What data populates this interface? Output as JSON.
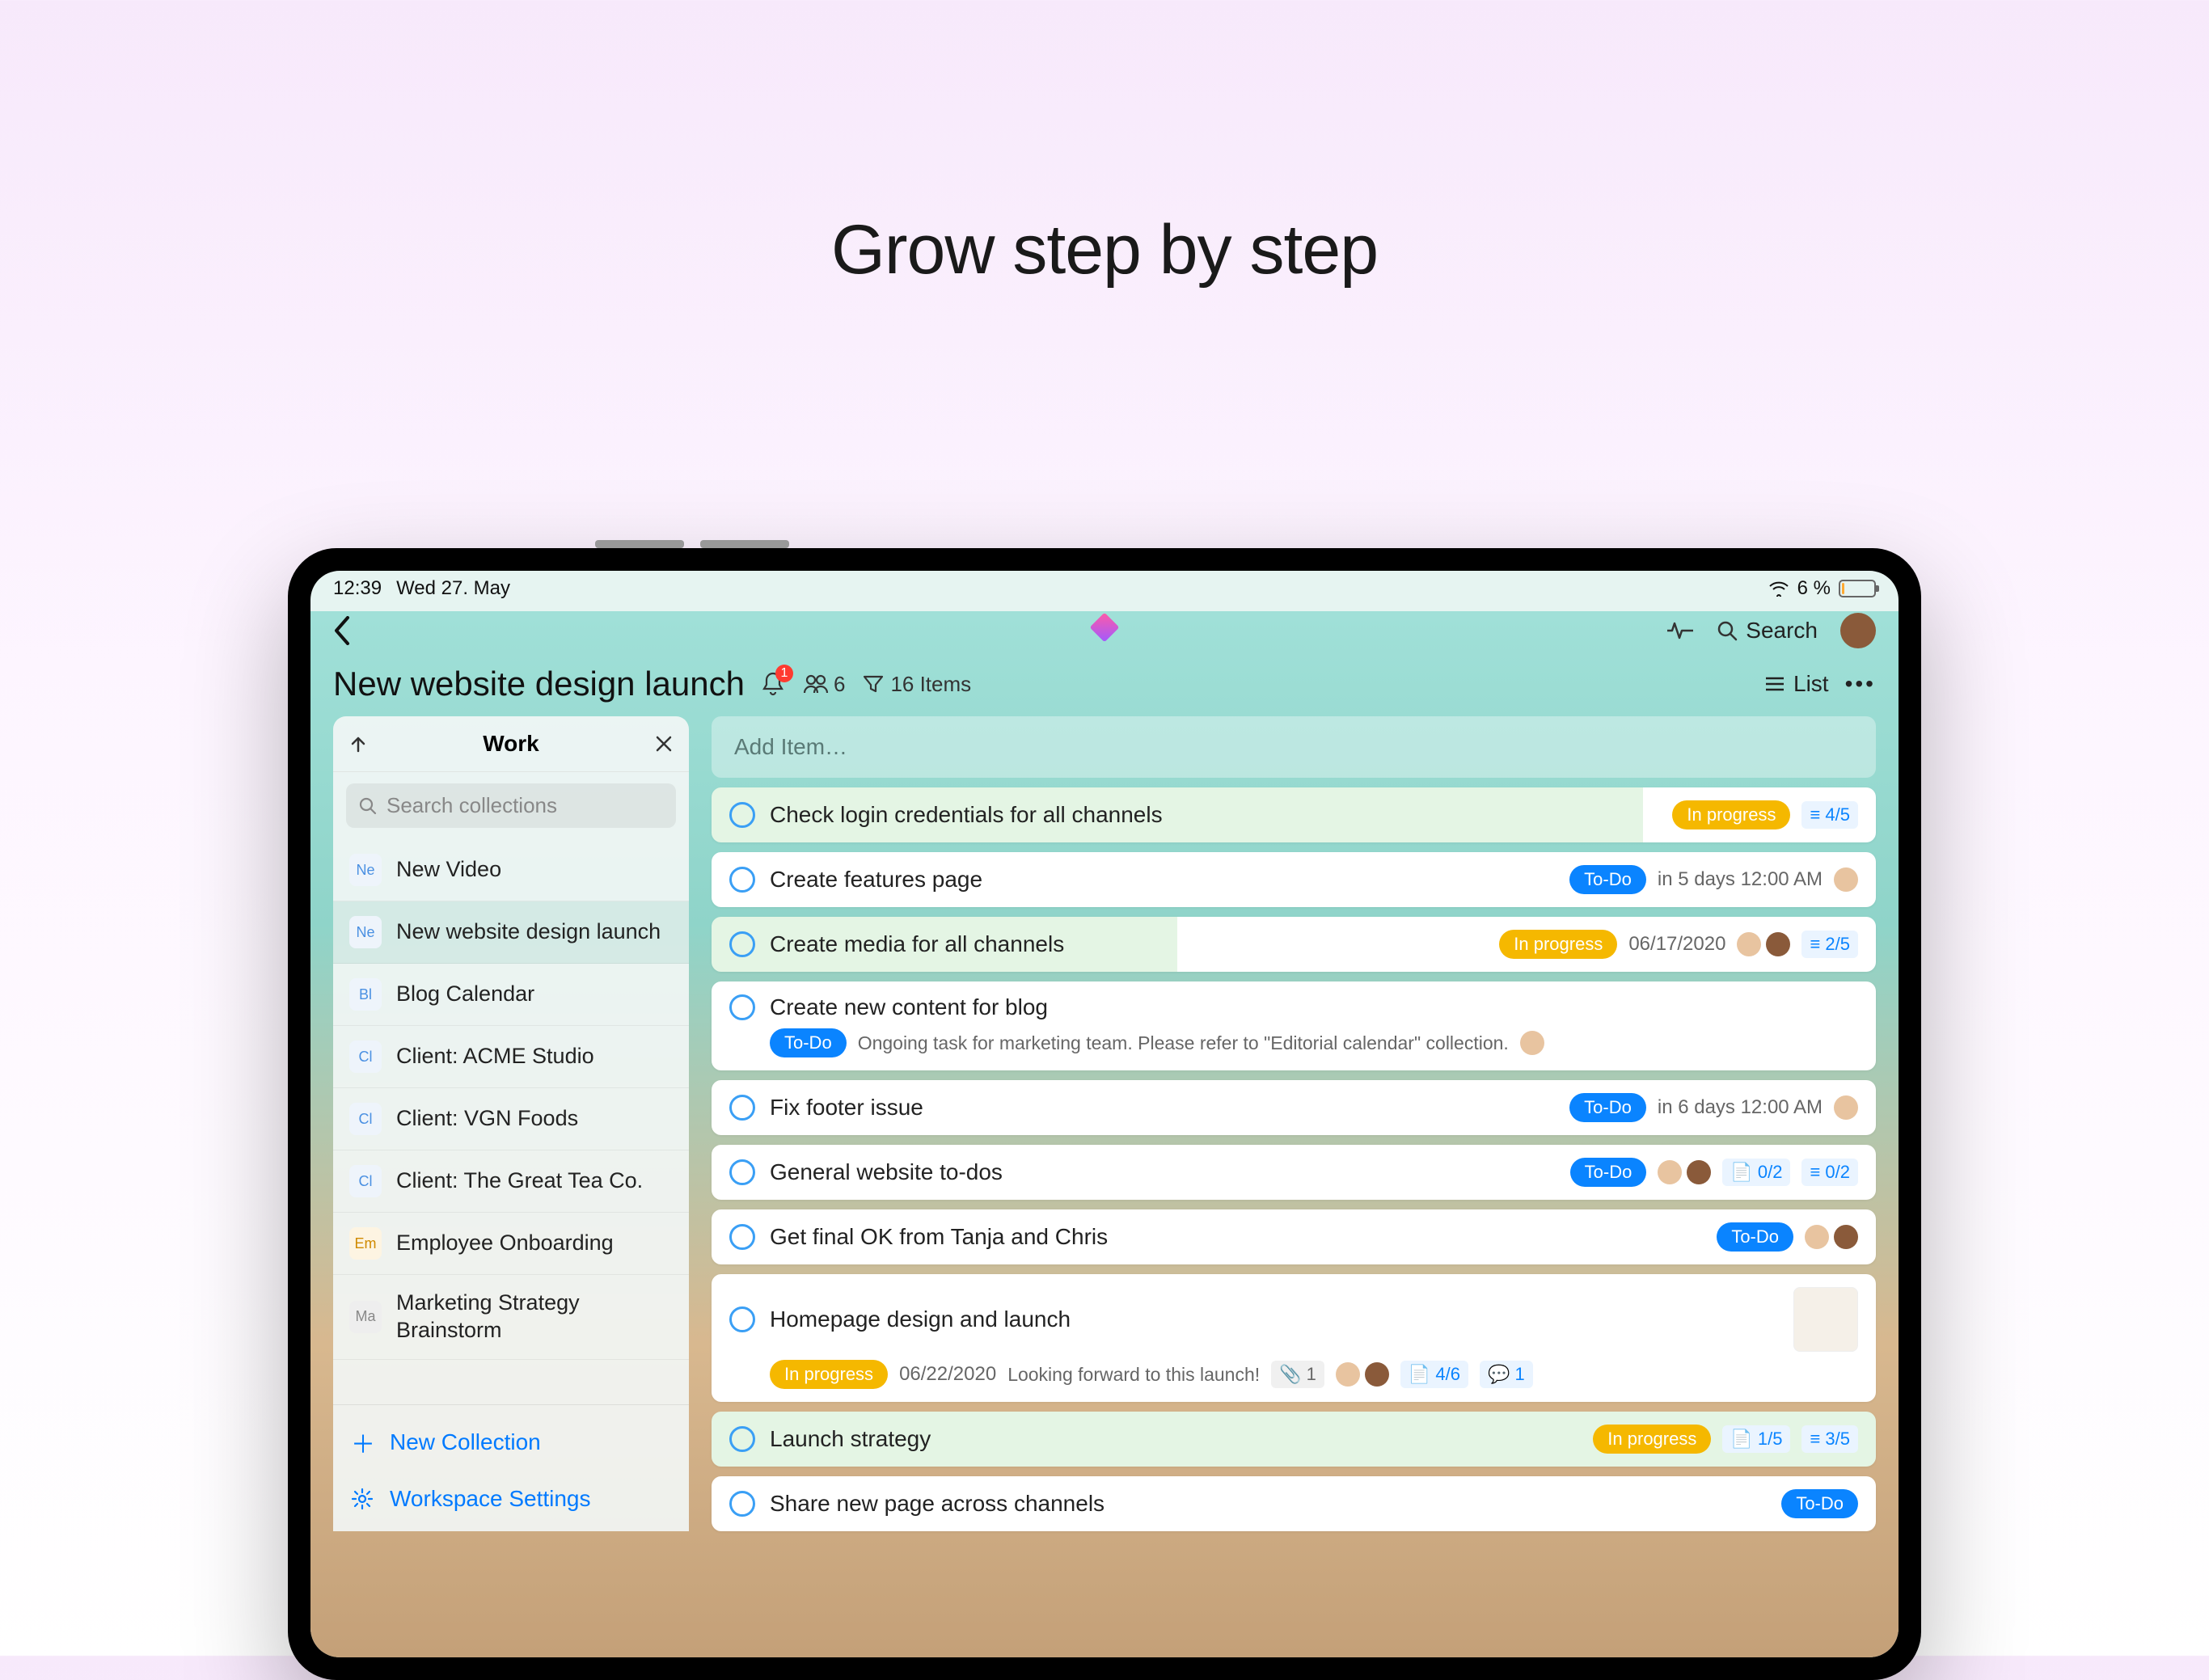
{
  "hero_title": "Grow step by step",
  "status_bar": {
    "time": "12:39",
    "date": "Wed 27. May",
    "battery_pct": "6 %"
  },
  "topbar": {
    "search_label": "Search"
  },
  "header": {
    "title": "New website design launch",
    "notification_count": "1",
    "members_count": "6",
    "items_count": "16 Items",
    "view_label": "List"
  },
  "sidebar": {
    "title": "Work",
    "search_placeholder": "Search collections",
    "collections": [
      {
        "badge": "Ne",
        "label": "New Video",
        "badge_class": ""
      },
      {
        "badge": "Ne",
        "label": "New website design launch",
        "badge_class": "",
        "selected": true
      },
      {
        "badge": "Bl",
        "label": "Blog Calendar",
        "badge_class": ""
      },
      {
        "badge": "Cl",
        "label": "Client: ACME Studio",
        "badge_class": ""
      },
      {
        "badge": "Cl",
        "label": "Client: VGN Foods",
        "badge_class": ""
      },
      {
        "badge": "Cl",
        "label": "Client: The Great Tea Co.",
        "badge_class": ""
      },
      {
        "badge": "Em",
        "label": "Employee Onboarding",
        "badge_class": "em"
      },
      {
        "badge": "Ma",
        "label": "Marketing Strategy Brainstorm",
        "badge_class": "ma"
      }
    ],
    "footer": {
      "new_collection": "New Collection",
      "workspace_settings": "Workspace Settings"
    }
  },
  "main": {
    "add_placeholder": "Add Item…",
    "tasks": [
      {
        "title": "Check login credentials for all channels",
        "status": "In progress",
        "status_class": "inprog",
        "progress": 80,
        "chips": [
          {
            "text": "4/5",
            "type": "list"
          }
        ]
      },
      {
        "title": "Create features page",
        "status": "To-Do",
        "status_class": "todo",
        "date": "in 5 days 12:00 AM",
        "avatars": 1
      },
      {
        "title": "Create media for all channels",
        "status": "In progress",
        "status_class": "inprog",
        "progress": 40,
        "date": "06/17/2020",
        "avatars": 2,
        "chips": [
          {
            "text": "2/5",
            "type": "list"
          }
        ]
      },
      {
        "title": "Create new content for blog",
        "status": "To-Do",
        "status_class": "todo",
        "note": "Ongoing task for marketing team. Please refer to \"Editorial calendar\" collection.",
        "avatars": 1,
        "sub": true
      },
      {
        "title": "Fix footer issue",
        "status": "To-Do",
        "status_class": "todo",
        "date": "in 6 days 12:00 AM",
        "avatars": 1
      },
      {
        "title": "General website to-dos",
        "status": "To-Do",
        "status_class": "todo",
        "avatars": 2,
        "chips": [
          {
            "text": "0/2",
            "type": "doc"
          },
          {
            "text": "0/2",
            "type": "list"
          }
        ]
      },
      {
        "title": "Get final OK from Tanja and Chris",
        "status": "To-Do",
        "status_class": "todo",
        "avatars": 2
      },
      {
        "title": "Homepage design and launch",
        "status": "In progress",
        "status_class": "inprog",
        "date": "06/22/2020",
        "note": "Looking forward to this launch!",
        "attach": "1",
        "avatars": 2,
        "chips": [
          {
            "text": "4/6",
            "type": "doc"
          },
          {
            "text": "1",
            "type": "comment"
          }
        ],
        "thumb": true,
        "sub": true
      },
      {
        "title": "Launch strategy",
        "status": "In progress",
        "status_class": "inprog",
        "progress": 100,
        "chips": [
          {
            "text": "1/5",
            "type": "doc"
          },
          {
            "text": "3/5",
            "type": "list"
          }
        ]
      },
      {
        "title": "Share new page across channels",
        "status": "To-Do",
        "status_class": "todo"
      }
    ]
  }
}
